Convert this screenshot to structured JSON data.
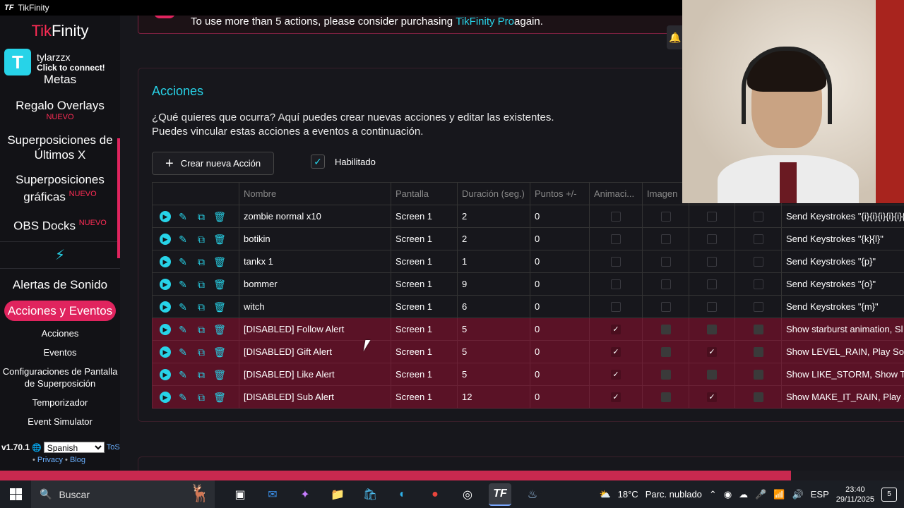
{
  "window": {
    "title": "TikFinity",
    "icon": "TF"
  },
  "brand": {
    "tik": "Tik",
    "finity": "Finity"
  },
  "user": {
    "avatar_letter": "T",
    "name": "tylarzzx",
    "status": "Click to connect!"
  },
  "sidebar": {
    "items": [
      {
        "label": "Metas"
      },
      {
        "label": "Regalo Overlays",
        "badge": "NUEVO"
      },
      {
        "label": "Superposiciones de Últimos X"
      },
      {
        "label": "Superposiciones gráficas",
        "badge": "NUEVO"
      },
      {
        "label": "OBS Docks",
        "badge": "NUEVO"
      },
      {
        "label": "Alertas de Sonido"
      },
      {
        "label": "Acciones y Eventos"
      }
    ],
    "subitems": [
      "Acciones",
      "Eventos",
      "Configuraciones de Pantalla de Superposición",
      "Temporizador",
      "Event Simulator"
    ],
    "footer": {
      "version": "v1.70.1",
      "language": "Spanish",
      "tos": "ToS",
      "privacy": "Privacy",
      "blog": "Blog",
      "sep": "•"
    }
  },
  "banner": {
    "text": "To use more than 5 actions, please consider purchasing ",
    "link": "TikFinity Pro",
    "suffix": " again."
  },
  "card": {
    "title": "Acciones",
    "desc1": "¿Qué quieres que ocurra? Aquí puedes crear nuevas acciones y editar las existentes.",
    "desc2": "Puedes vincular estas acciones a eventos a continuación.",
    "create_label": "Crear nueva Acción",
    "enabled_label": "Habilitado"
  },
  "table": {
    "headers": [
      "",
      "Nombre",
      "Pantalla",
      "Duración (seg.)",
      "Puntos +/-",
      "Animaci...",
      "Imagen",
      "",
      "",
      ""
    ],
    "rows": [
      {
        "name": "zombie normal x10",
        "screen": "Screen 1",
        "duration": "2",
        "points": "0",
        "anim": false,
        "img": false,
        "c3": false,
        "c4": false,
        "desc": "Send Keystrokes \"{i}{i}{i}{i}{i}{",
        "disabled": false
      },
      {
        "name": "botikin",
        "screen": "Screen 1",
        "duration": "2",
        "points": "0",
        "anim": false,
        "img": false,
        "c3": false,
        "c4": false,
        "desc": "Send Keystrokes \"{k}{l}\"",
        "disabled": false
      },
      {
        "name": "tankx 1",
        "screen": "Screen 1",
        "duration": "1",
        "points": "0",
        "anim": false,
        "img": false,
        "c3": false,
        "c4": false,
        "desc": "Send Keystrokes \"{p}\"",
        "disabled": false
      },
      {
        "name": "bommer",
        "screen": "Screen 1",
        "duration": "9",
        "points": "0",
        "anim": false,
        "img": false,
        "c3": false,
        "c4": false,
        "desc": "Send Keystrokes \"{o}\"",
        "disabled": false
      },
      {
        "name": "witch",
        "screen": "Screen 1",
        "duration": "6",
        "points": "0",
        "anim": false,
        "img": false,
        "c3": false,
        "c4": false,
        "desc": "Send Keystrokes \"{m}\"",
        "disabled": false
      },
      {
        "name": "[DISABLED] Follow Alert",
        "screen": "Screen 1",
        "duration": "5",
        "points": "0",
        "anim": true,
        "img": false,
        "c3": false,
        "c4": false,
        "desc": "Show starburst animation, Sl",
        "disabled": true
      },
      {
        "name": "[DISABLED] Gift Alert",
        "screen": "Screen 1",
        "duration": "5",
        "points": "0",
        "anim": true,
        "img": false,
        "c3": true,
        "c4": false,
        "desc": "Show LEVEL_RAIN, Play Sour",
        "disabled": true
      },
      {
        "name": "[DISABLED] Like Alert",
        "screen": "Screen 1",
        "duration": "5",
        "points": "0",
        "anim": true,
        "img": false,
        "c3": false,
        "c4": false,
        "desc": "Show LIKE_STORM, Show Te",
        "disabled": true
      },
      {
        "name": "[DISABLED] Sub Alert",
        "screen": "Screen 1",
        "duration": "12",
        "points": "0",
        "anim": true,
        "img": false,
        "c3": true,
        "c4": false,
        "desc": "Show MAKE_IT_RAIN, Play S",
        "disabled": true
      }
    ]
  },
  "taskbar": {
    "search_placeholder": "Buscar",
    "weather": "18°C",
    "weather_desc": "Parc. nublado",
    "lang": "ESP",
    "time": "23:40",
    "date": "29/11/2025",
    "notif_count": "5"
  },
  "colors": {
    "accent": "#27d3e8",
    "brand": "#fe2c55",
    "active": "#e0245e"
  }
}
